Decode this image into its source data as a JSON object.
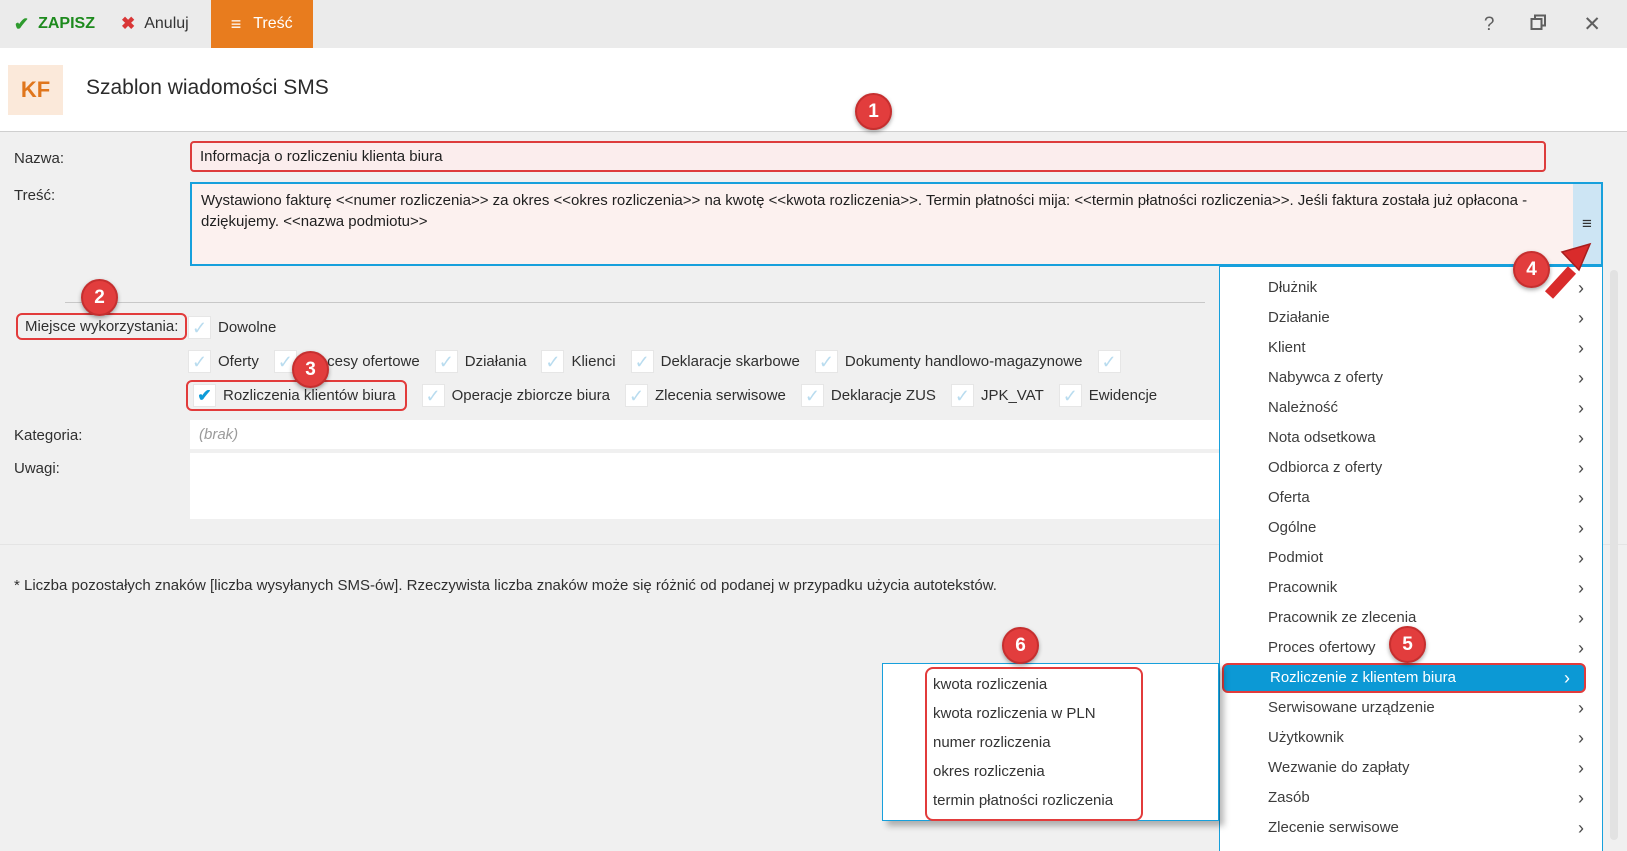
{
  "toolbar": {
    "save_label": "ZAPISZ",
    "cancel_label": "Anuluj",
    "content_tab_label": "Treść",
    "help_label": "?"
  },
  "header": {
    "logo": "KF",
    "title": "Szablon wiadomości SMS"
  },
  "form": {
    "nazwa_label": "Nazwa:",
    "nazwa_value": "Informacja o rozliczeniu klienta biura",
    "tresc_label": "Treść:",
    "tresc_value": "Wystawiono fakturę <<numer rozliczenia>> za okres <<okres rozliczenia>> na kwotę <<kwota rozliczenia>>. Termin płatności mija: <<termin płatności rozliczenia>>. Jeśli faktura została już opłacona - dziękujemy. <<nazwa podmiotu>>",
    "miejsce_label": "Miejsce wykorzystania:",
    "kategoria_label": "Kategoria:",
    "kategoria_placeholder": "(brak)",
    "uwagi_label": "Uwagi:",
    "uwagi_value": "",
    "footnote": "* Liczba pozostałych znaków [liczba wysyłanych SMS-ów]. Rzeczywista liczba znaków może się różnić od podanej w przypadku użycia autotekstów."
  },
  "usage": {
    "row1": [
      {
        "label": "Dowolne",
        "checked": false
      }
    ],
    "row2": [
      {
        "label": "Oferty",
        "checked": false
      },
      {
        "label": "Procesy ofertowe",
        "checked": false
      },
      {
        "label": "Działania",
        "checked": false
      },
      {
        "label": "Klienci",
        "checked": false
      },
      {
        "label": "Deklaracje skarbowe",
        "checked": false
      },
      {
        "label": "Dokumenty handlowo-magazynowe",
        "checked": false
      },
      {
        "label": "",
        "checked": false
      }
    ],
    "row3": [
      {
        "label": "Rozliczenia klientów biura",
        "checked": true
      },
      {
        "label": "Operacje zbiorcze biura",
        "checked": false
      },
      {
        "label": "Zlecenia serwisowe",
        "checked": false
      },
      {
        "label": "Deklaracje ZUS",
        "checked": false
      },
      {
        "label": "JPK_VAT",
        "checked": false
      },
      {
        "label": "Ewidencje",
        "checked": false
      }
    ]
  },
  "menu": {
    "items": [
      "Dłużnik",
      "Działanie",
      "Klient",
      "Nabywca z oferty",
      "Należność",
      "Nota odsetkowa",
      "Odbiorca z oferty",
      "Oferta",
      "Ogólne",
      "Podmiot",
      "Pracownik",
      "Pracownik ze zlecenia",
      "Proces ofertowy",
      "Rozliczenie z klientem biura",
      "Serwisowane urządzenie",
      "Użytkownik",
      "Wezwanie do zapłaty",
      "Zasób",
      "Zlecenie serwisowe"
    ],
    "selected_item": "Rozliczenie z klientem biura"
  },
  "submenu": {
    "items": [
      "kwota rozliczenia",
      "kwota rozliczenia w PLN",
      "numer rozliczenia",
      "okres rozliczenia",
      "termin płatności rozliczenia"
    ]
  },
  "icons": {
    "check_save": "✔",
    "x_cancel": "✖",
    "hamburger": "≡",
    "close": "✕",
    "chevron": "›",
    "check_light": "✓",
    "check_on": "✔"
  },
  "annotations": [
    "1",
    "2",
    "3",
    "4",
    "5",
    "6"
  ],
  "colors": {
    "accent_blue": "#17a0dc",
    "selected_blue": "#0c99d5",
    "tab_orange": "#e87c1e",
    "save_green": "#2e9b2e",
    "cancel_red": "#d93636",
    "annotation_red": "#e23b3b",
    "field_pink": "#fbeded",
    "strip_blue": "#cde5f4"
  }
}
